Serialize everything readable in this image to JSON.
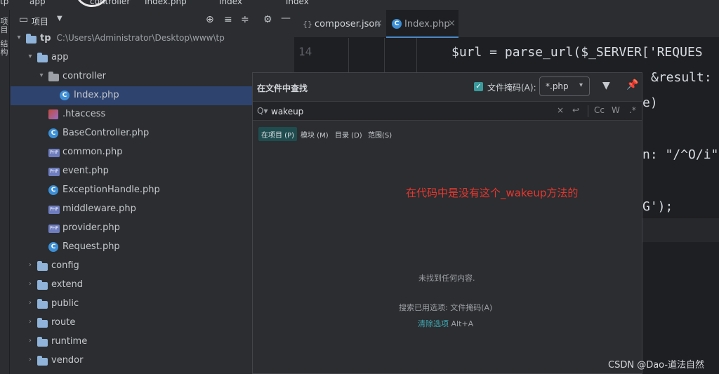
{
  "breadcrumb": [
    "tp",
    "app",
    "controller",
    "Index.php",
    "Index",
    "index"
  ],
  "strip": [
    "项",
    "目",
    "结",
    "构"
  ],
  "project": {
    "title": "项目",
    "tree": [
      {
        "label": "tp",
        "path": "C:\\Users\\Administrator\\Desktop\\www\\tp",
        "kind": "folder",
        "depth": 0,
        "chevron": "▾"
      },
      {
        "label": "app",
        "kind": "folder",
        "depth": 1,
        "chevron": "▾"
      },
      {
        "label": "controller",
        "kind": "folder-gray",
        "depth": 2,
        "chevron": "▾"
      },
      {
        "label": "Index.php",
        "kind": "class",
        "depth": 3,
        "chevron": "",
        "selected": true
      },
      {
        "label": ".htaccess",
        "kind": "htaccess",
        "depth": 2,
        "chevron": ""
      },
      {
        "label": "BaseController.php",
        "kind": "class",
        "depth": 2,
        "chevron": ""
      },
      {
        "label": "common.php",
        "kind": "php",
        "depth": 2,
        "chevron": ""
      },
      {
        "label": "event.php",
        "kind": "php",
        "depth": 2,
        "chevron": ""
      },
      {
        "label": "ExceptionHandle.php",
        "kind": "class",
        "depth": 2,
        "chevron": ""
      },
      {
        "label": "middleware.php",
        "kind": "php",
        "depth": 2,
        "chevron": ""
      },
      {
        "label": "provider.php",
        "kind": "php",
        "depth": 2,
        "chevron": ""
      },
      {
        "label": "Request.php",
        "kind": "class",
        "depth": 2,
        "chevron": ""
      },
      {
        "label": "config",
        "kind": "folder",
        "depth": 1,
        "chevron": "›"
      },
      {
        "label": "extend",
        "kind": "folder",
        "depth": 1,
        "chevron": "›"
      },
      {
        "label": "public",
        "kind": "folder",
        "depth": 1,
        "chevron": "›"
      },
      {
        "label": "route",
        "kind": "folder",
        "depth": 1,
        "chevron": "›"
      },
      {
        "label": "runtime",
        "kind": "folder",
        "depth": 1,
        "chevron": "›"
      },
      {
        "label": "vendor",
        "kind": "folder",
        "depth": 1,
        "chevron": "›"
      }
    ]
  },
  "editor": {
    "tabs": [
      {
        "label": "composer.json",
        "close": "×"
      },
      {
        "label": "Index.php",
        "close": "×",
        "active": true
      }
    ],
    "line_number": "14",
    "code": {
      "line1": "$url = parse_url($_SERVER['REQUES",
      "frag_result": "&result: $q",
      "frag_e": "e)",
      "frag_n": "n: \"/^O/i\",",
      "frag_g": "G');"
    }
  },
  "find": {
    "title": "在文件中查找",
    "file_mask_label": "文件掩码(A):",
    "file_mask_checked": true,
    "file_mask_value": "*.php",
    "query": "wakeup",
    "tools": [
      "×",
      "↩",
      "Cc",
      "W",
      ".*"
    ],
    "scopes": [
      {
        "label": "在项目 (P)",
        "active": true
      },
      {
        "label": "模块 (M)"
      },
      {
        "label": "目录 (D)"
      },
      {
        "label": "范围(S)"
      }
    ],
    "annotation": "在代码中是没有这个_wakeup方法的",
    "no_results": "未找到任何内容.",
    "options_used": "搜索已用选项: 文件掩码(A)",
    "clear_link": "清除选项",
    "clear_shortcut": "Alt+A"
  },
  "watermark": "CSDN @Dao-道法自然",
  "colors": {
    "accent": "#4a88c7",
    "selection": "#2e436e",
    "annotation": "#e8362e",
    "link": "#3fa8b3"
  }
}
